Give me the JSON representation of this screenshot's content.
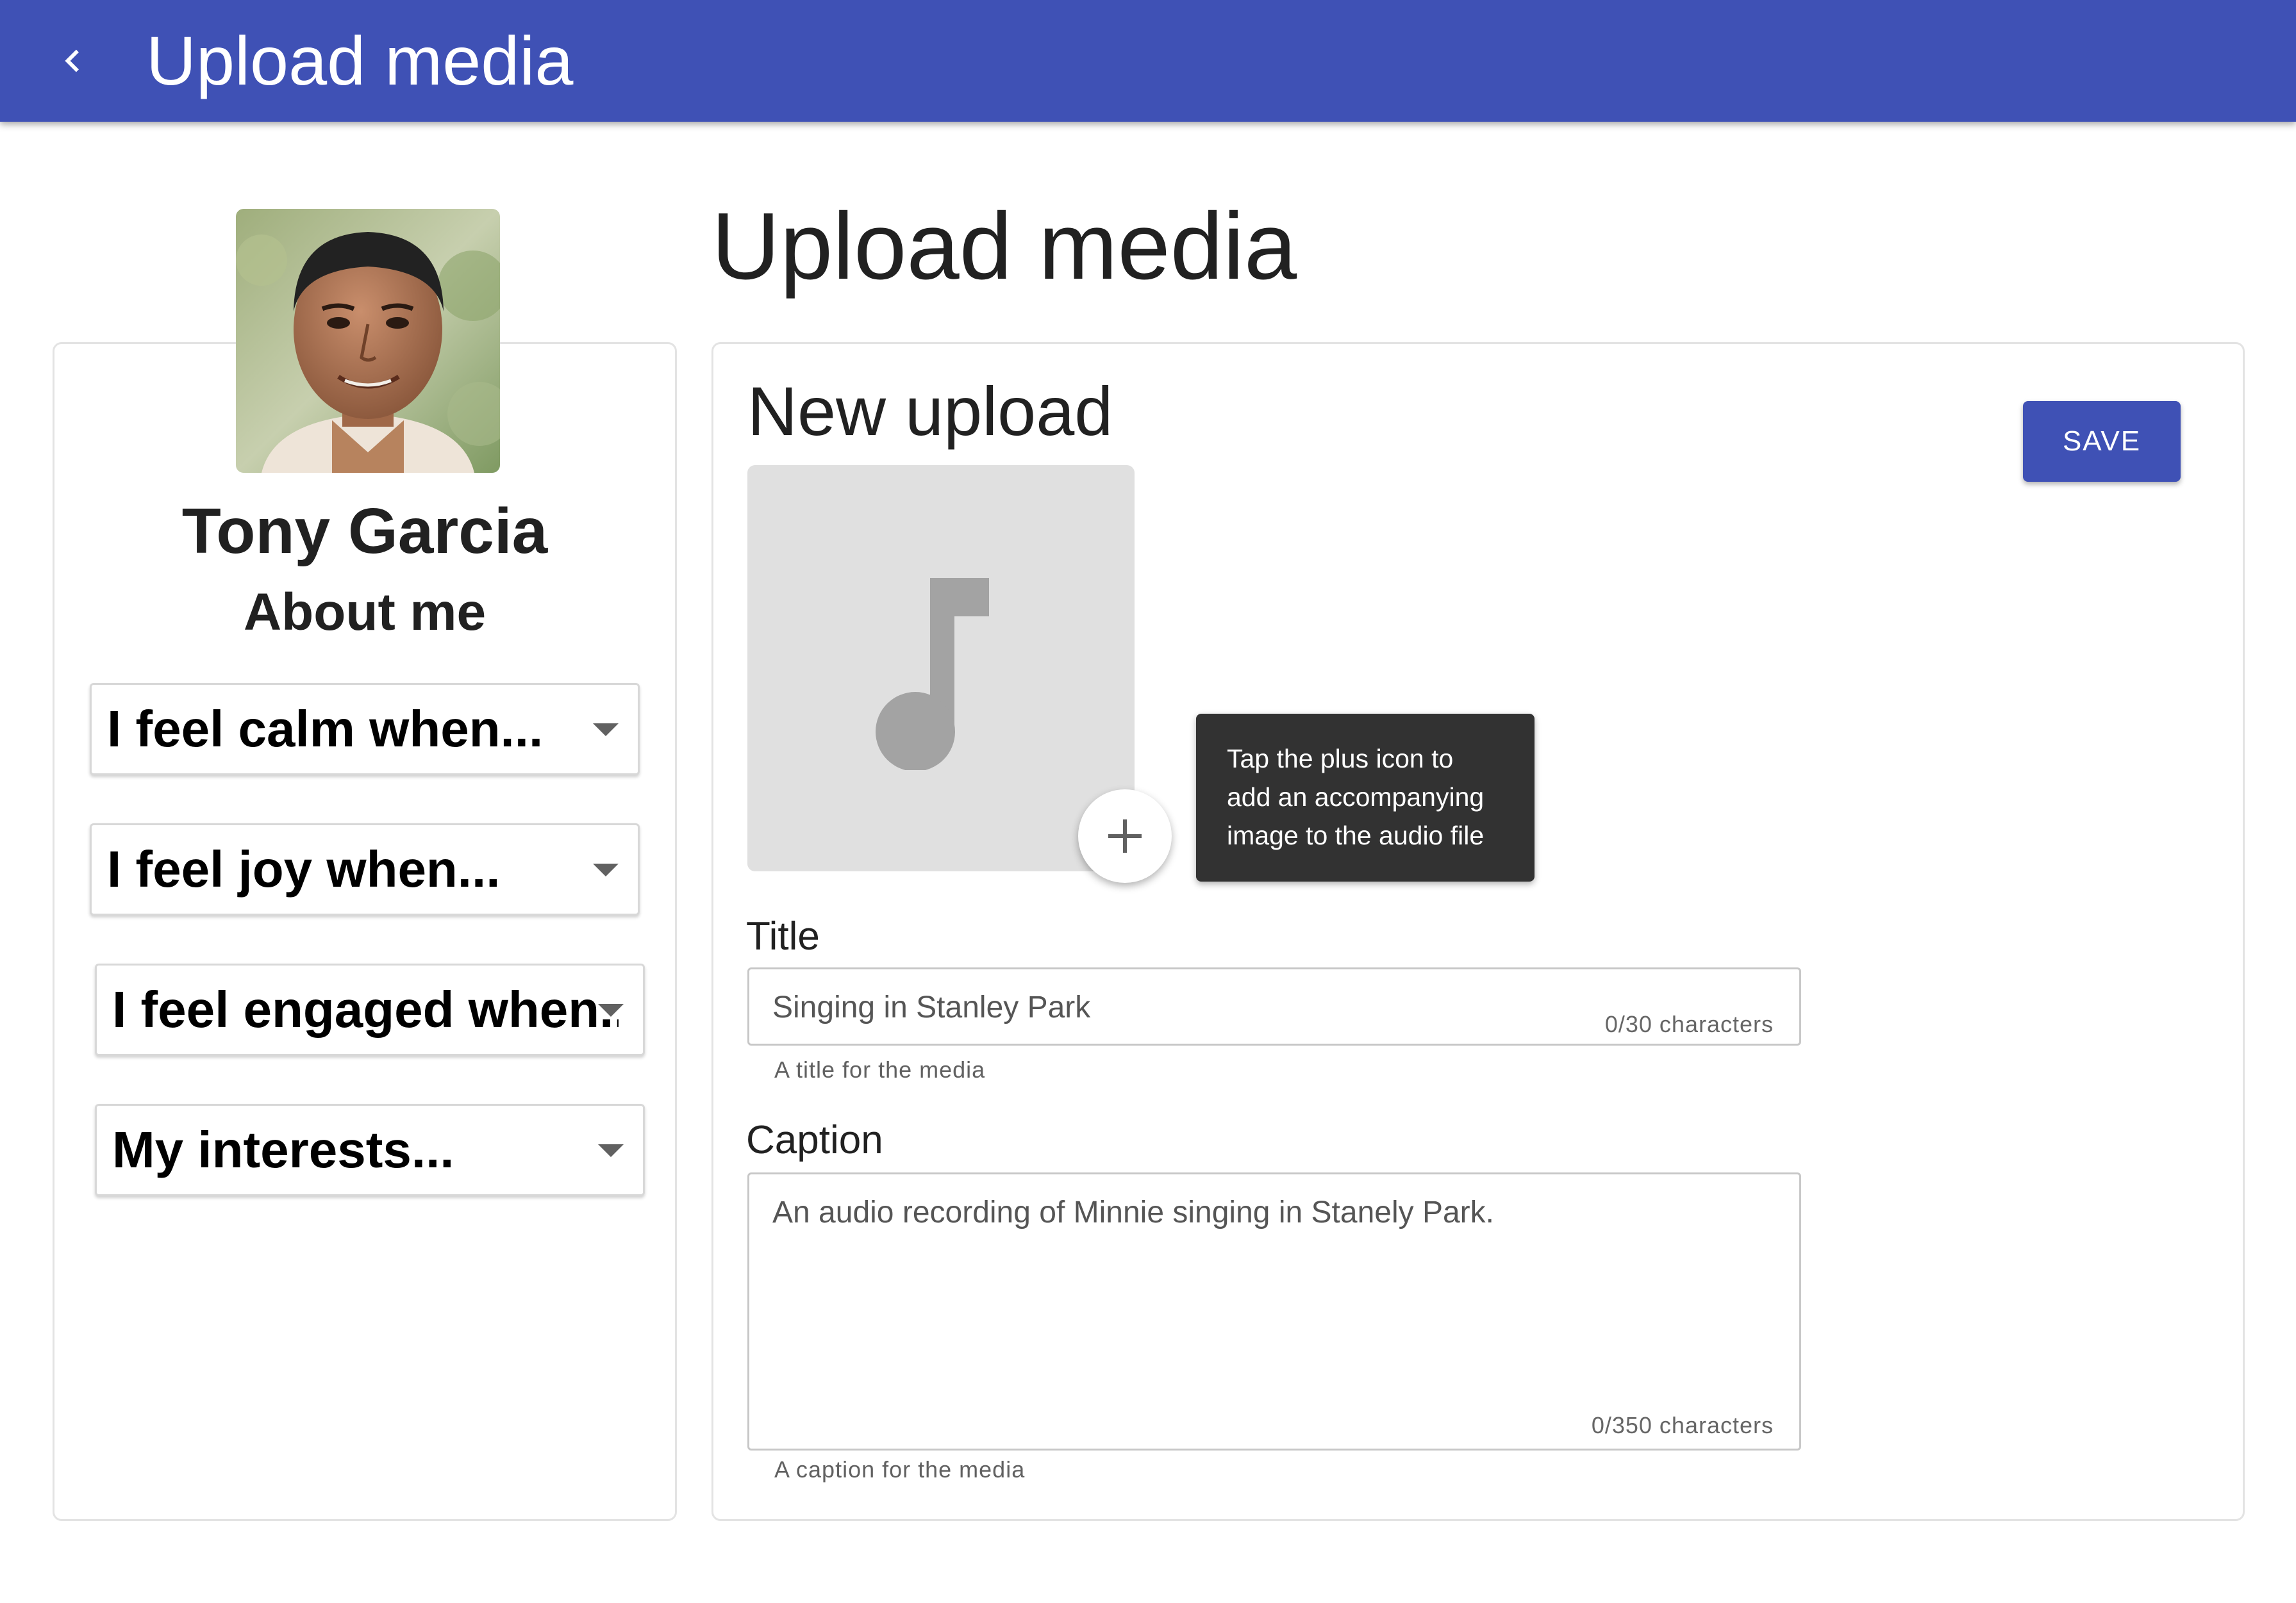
{
  "app_bar": {
    "title": "Upload media",
    "back_icon": "chevron-left-icon",
    "color": "#3f51b5"
  },
  "profile": {
    "name": "Tony Garcia",
    "about_heading": "About me",
    "avatar_alt": "Tony Garcia",
    "sections": [
      {
        "label": "I feel calm when..."
      },
      {
        "label": "I feel joy when..."
      },
      {
        "label": "I feel engaged when..."
      },
      {
        "label": "My interests..."
      }
    ]
  },
  "page": {
    "title": "Upload media"
  },
  "upload": {
    "card_title": "New upload",
    "save_label": "SAVE",
    "media_icon": "music-note-icon",
    "add_icon": "plus-icon",
    "tooltip_lines": [
      "Tap the plus icon to",
      "add an accompanying",
      "image to the audio file"
    ],
    "title_field": {
      "label": "Title",
      "value": "Singing in Stanley Park",
      "counter": "0/30 characters",
      "helper": "A title for the media"
    },
    "caption_field": {
      "label": "Caption",
      "value": "An audio recording of Minnie singing in Stanely Park.",
      "counter": "0/350 characters",
      "helper": "A caption for the media"
    }
  },
  "colors": {
    "primary": "#3f51b5",
    "tooltip_bg": "#323232",
    "media_placeholder": "#e0e0e0"
  }
}
